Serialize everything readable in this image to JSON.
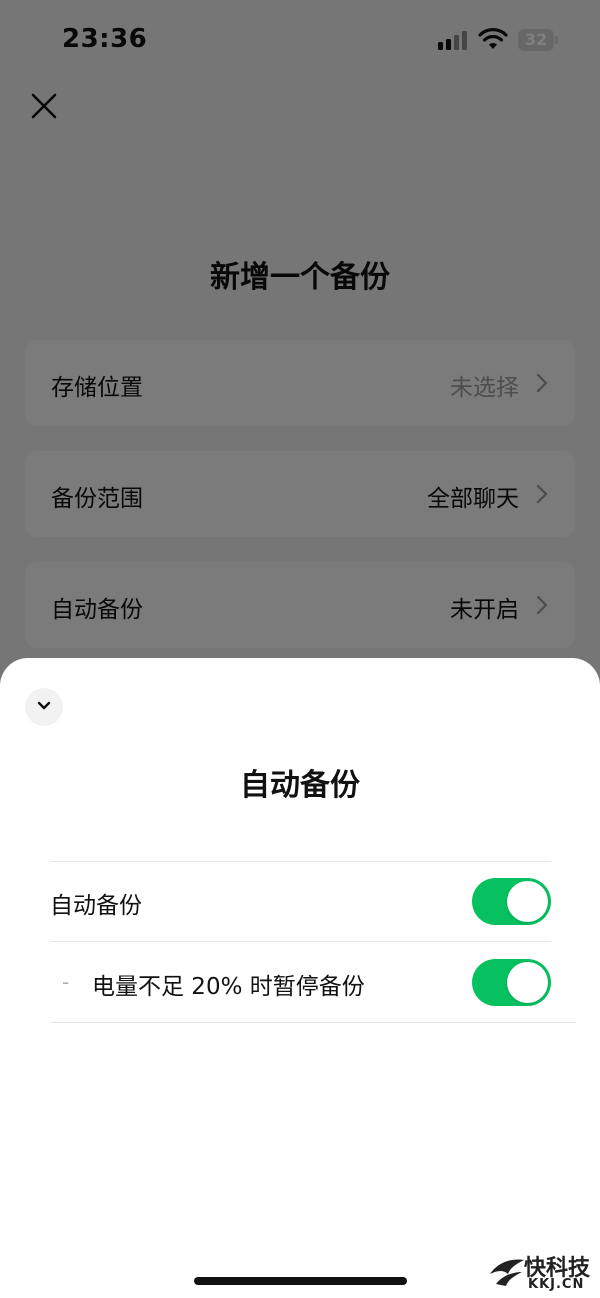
{
  "status_bar": {
    "time": "23:36",
    "battery_level": "32"
  },
  "page": {
    "title": "新增一个备份",
    "rows": [
      {
        "label": "存储位置",
        "value": "未选择",
        "value_muted": true
      },
      {
        "label": "备份范围",
        "value": "全部聊天",
        "value_muted": false
      },
      {
        "label": "自动备份",
        "value": "未开启",
        "value_muted": false
      }
    ]
  },
  "sheet": {
    "title": "自动备份",
    "settings": [
      {
        "label": "自动备份",
        "enabled": true
      },
      {
        "label": "电量不足 20% 时暂停备份",
        "prefix": "-",
        "enabled": true
      }
    ]
  },
  "watermark": {
    "cn": "快科技",
    "en": "KKJ.CN"
  },
  "colors": {
    "toggle_on": "#07c160",
    "overlay": "rgba(0,0,0,0.5)"
  },
  "icons": [
    "close-icon",
    "chevron-right-icon",
    "chevron-down-icon",
    "signal-icon",
    "wifi-icon",
    "battery-icon"
  ]
}
